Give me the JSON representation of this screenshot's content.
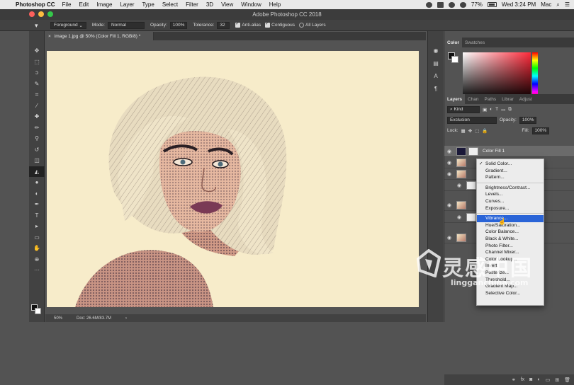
{
  "menubar": {
    "app_name": "Photoshop CC",
    "items": [
      "File",
      "Edit",
      "Image",
      "Layer",
      "Type",
      "Select",
      "Filter",
      "3D",
      "View",
      "Window",
      "Help"
    ],
    "battery": "77%",
    "clock": "Wed 3:24 PM",
    "user": "Mac"
  },
  "window": {
    "title": "Adobe Photoshop CC 2018"
  },
  "options": {
    "fill_source": "Foreground",
    "mode_label": "Mode:",
    "mode_value": "Normal",
    "opacity_label": "Opacity:",
    "opacity_value": "100%",
    "tolerance_label": "Tolerance:",
    "tolerance_value": "32",
    "anti_alias": "Anti-alias",
    "contiguous": "Contiguous",
    "all_layers": "All Layers"
  },
  "document": {
    "tab_title": "image 1.jpg @ 50% (Color Fill 1, RGB/8) *",
    "zoom": "50%",
    "doc_size": "Doc: 26.6M/83.7M"
  },
  "panels": {
    "color_tabs": [
      "Color",
      "Swatches"
    ],
    "layer_tabs": [
      "Layers",
      "Chan",
      "Paths",
      "Librar",
      "Adjust"
    ],
    "filter_kind": "Kind",
    "blend_mode": "Exclusion",
    "opacity_label": "Opacity:",
    "opacity_value": "100%",
    "lock_label": "Lock:",
    "fill_label": "Fill:",
    "fill_value": "100%",
    "selected_layer": "Color Fill 1"
  },
  "adjust_menu": {
    "items": [
      "Solid Color...",
      "Gradient...",
      "Pattern...",
      "Brightness/Contrast...",
      "Levels...",
      "Curves...",
      "Exposure...",
      "Vibrance...",
      "Hue/Saturation...",
      "Color Balance...",
      "Black & White...",
      "Photo Filter...",
      "Channel Mixer...",
      "Color Lookup...",
      "Invert",
      "Posterize...",
      "Threshold...",
      "Gradient Map...",
      "Selective Color..."
    ]
  },
  "watermark": {
    "brand": "灵感中国",
    "site": "lingganchina.com"
  },
  "colors": {
    "canvas": "#f7ecca",
    "menu_highlight": "#2a64d7",
    "ui_dark": "#535353"
  }
}
